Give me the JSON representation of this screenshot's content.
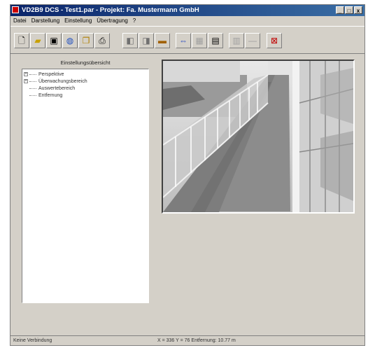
{
  "window": {
    "title": "VD2B9 DCS - Test1.par  -  Projekt: Fa. Mustermann GmbH",
    "controls": [
      "_",
      "□",
      "x"
    ]
  },
  "menu": [
    "Datei",
    "Darstellung",
    "Einstellung",
    "Übertragung",
    "?"
  ],
  "toolbar": {
    "buttons": [
      {
        "icon": "new-file-icon"
      },
      {
        "icon": "open-folder-icon"
      },
      {
        "icon": "save-disk-icon"
      },
      {
        "icon": "globe-icon"
      },
      {
        "icon": "copy-icon"
      },
      {
        "icon": "print-icon"
      },
      {
        "icon": "image-left-icon"
      },
      {
        "icon": "image-right-icon"
      },
      {
        "icon": "camera-icon"
      },
      {
        "icon": "view-arrows-icon"
      },
      {
        "icon": "grid-icon"
      },
      {
        "icon": "monitor-icon"
      },
      {
        "icon": "layout-icon"
      },
      {
        "icon": "dash-icon"
      },
      {
        "icon": "transfer-icon"
      }
    ]
  },
  "panel": {
    "title": "Einstellungsübersicht",
    "tree": [
      {
        "label": "Perspektive",
        "expand": "+"
      },
      {
        "label": "Überwachungsbereich",
        "expand": "+"
      },
      {
        "label": "Auswertebereich",
        "expand": ""
      },
      {
        "label": "Entfernung",
        "expand": ""
      }
    ]
  },
  "status": {
    "left": "Keine Verbindung",
    "right": "X = 336 Y = 76  Entfernung: 10.77 m"
  }
}
